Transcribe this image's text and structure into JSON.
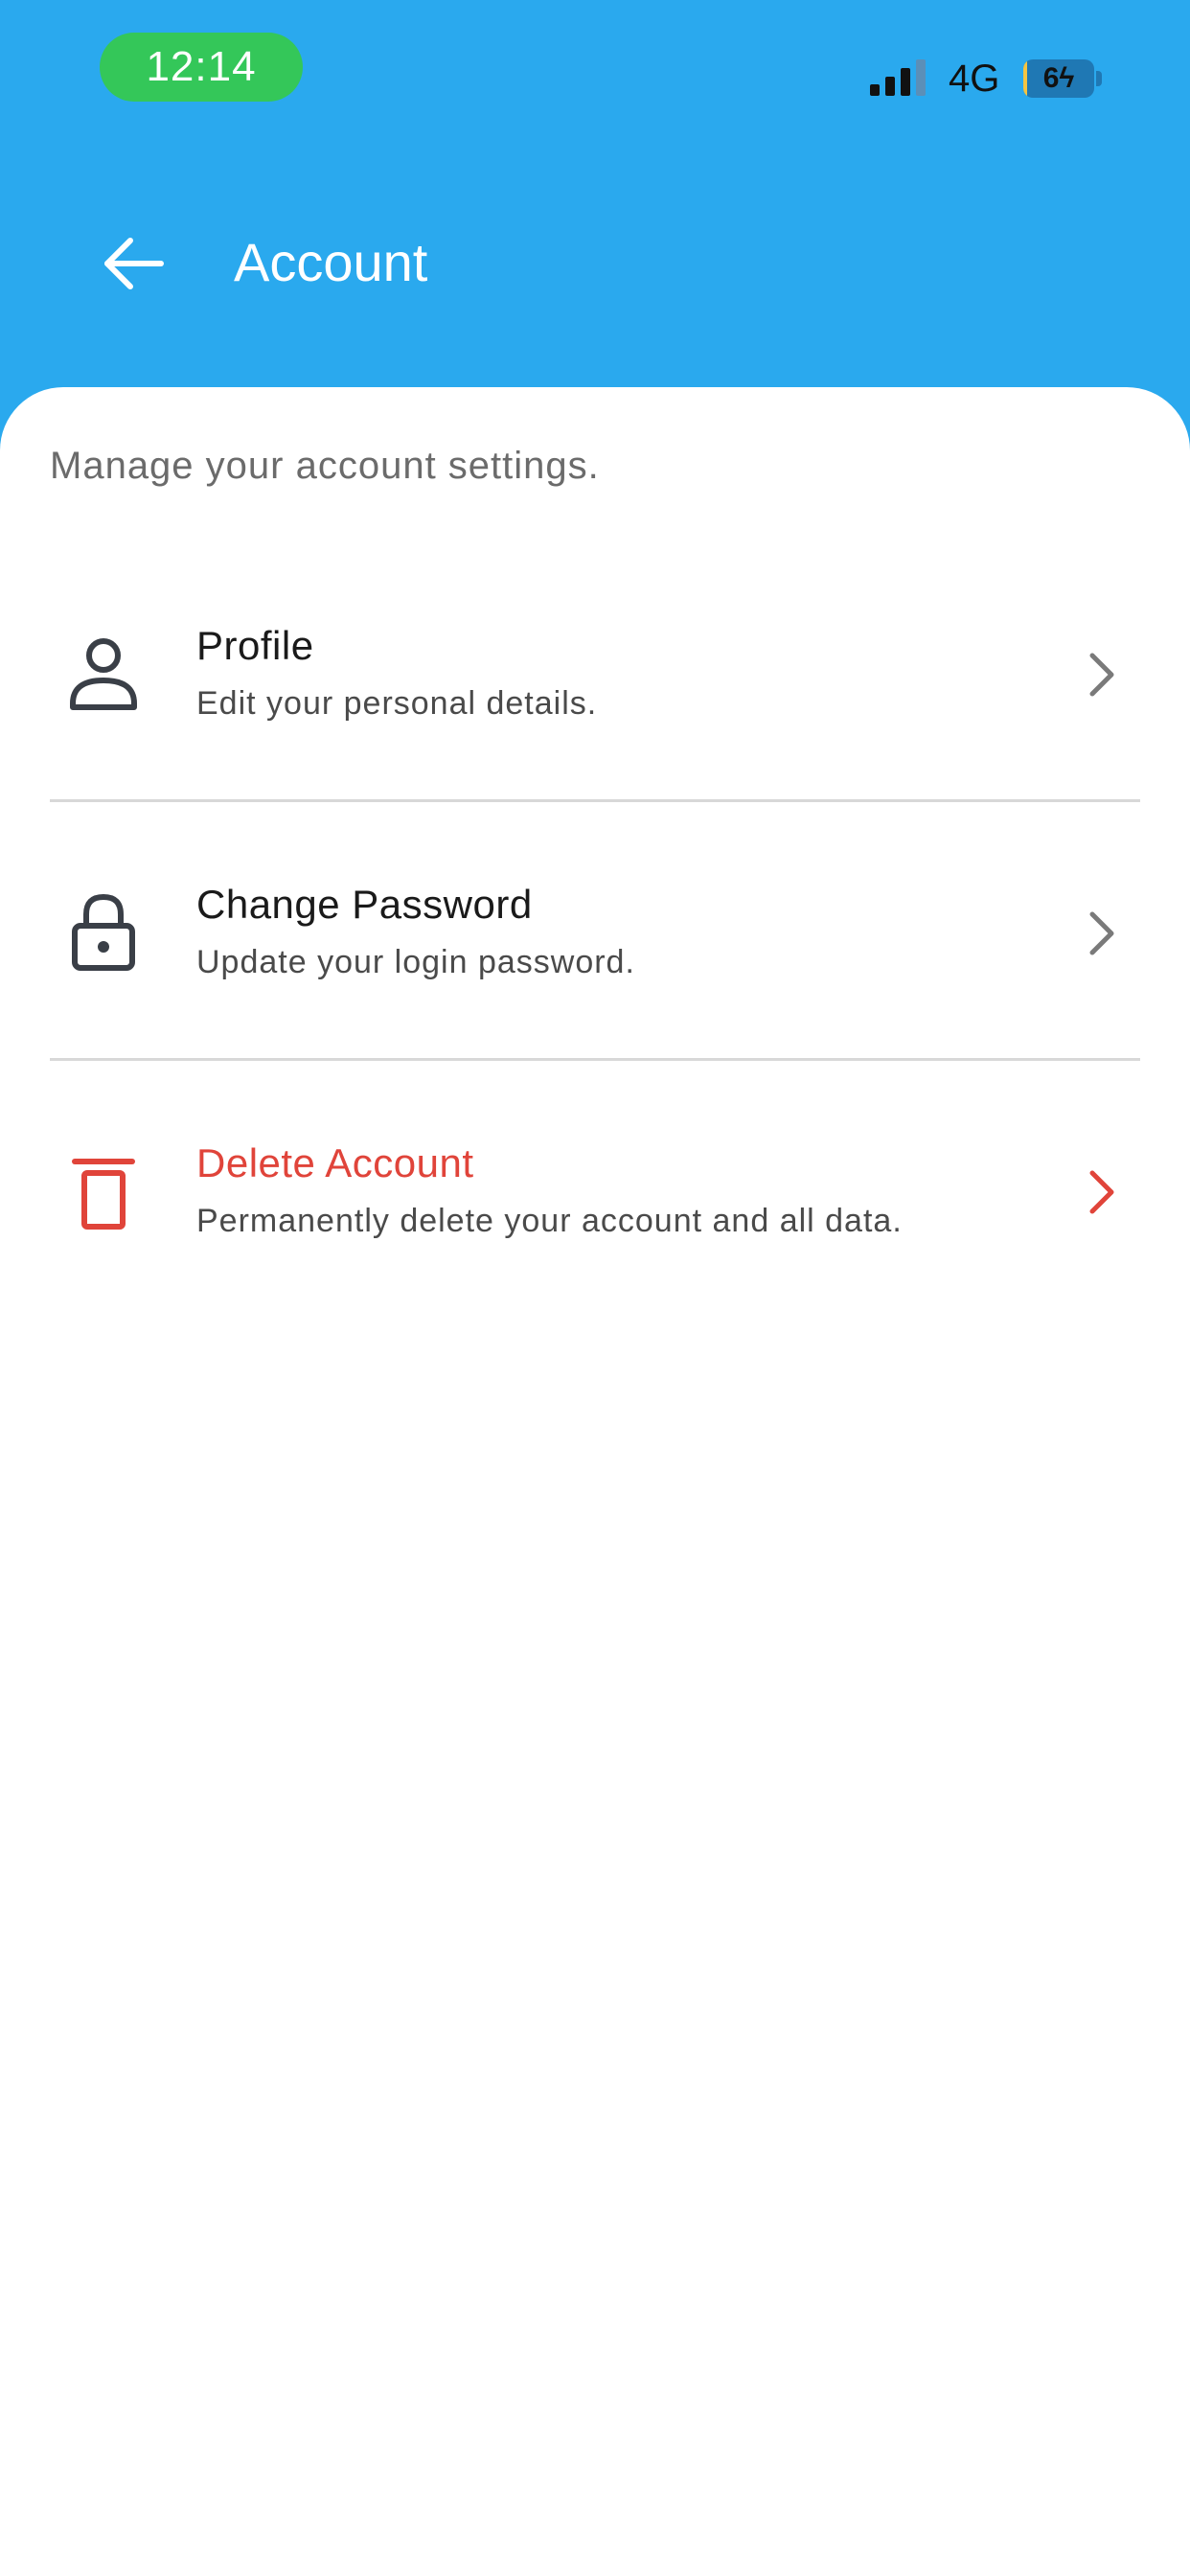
{
  "status_bar": {
    "time": "12:14",
    "network": "4G",
    "battery_level": "6",
    "battery_fraction": 0.06
  },
  "app_bar": {
    "title": "Account",
    "back_icon": "arrow-left-icon"
  },
  "content": {
    "subtitle": "Manage your account settings.",
    "items": [
      {
        "title": "Profile",
        "description": "Edit your personal details.",
        "icon": "person-icon"
      },
      {
        "title": "Change Password",
        "description": "Update your login password.",
        "icon": "lock-icon"
      },
      {
        "title": "Delete Account",
        "description": "Permanently delete your account and all data.",
        "icon": "trash-icon"
      }
    ]
  },
  "colors": {
    "header_background": "#2aa9ee",
    "time_pill": "#34c759",
    "danger": "#e0443a",
    "icon": "#3a3f47",
    "chevron": "#7a7a7a"
  }
}
